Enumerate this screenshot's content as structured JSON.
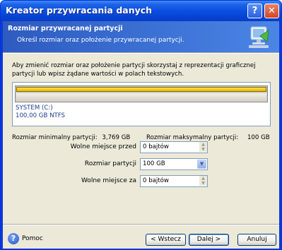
{
  "window": {
    "title": "Kreator przywracania danych",
    "help_glyph": "?",
    "close_glyph": "✕"
  },
  "header": {
    "title": "Rozmiar przywracanej partycji",
    "subtitle": "Określ rozmiar oraz położenie przywracanej partycji."
  },
  "description": "Aby zmienić rozmiar oraz położenie partycji skorzystaj z reprezentacji graficznej partycji lub wpisz żądane wartości w polach tekstowych.",
  "partition": {
    "name": "SYSTEM (C:)",
    "info": "100,00 GB  NTFS",
    "fill_fraction": 1.0
  },
  "size_limits": {
    "min_label": "Rozmiar minimalny partycji:",
    "min_value": "3,769 GB",
    "max_label": "Rozmiar maksymalny partycji:",
    "max_value": "100 GB"
  },
  "form": {
    "free_before_label": "Wolne miejsce przed",
    "free_before_value": "0 bajtów",
    "size_label": "Rozmiar partycji",
    "size_value": "100 GB",
    "free_after_label": "Wolne miejsce za",
    "free_after_value": "0 bajtów"
  },
  "footer": {
    "help_label": "Pomoc",
    "back_label": "< Wstecz",
    "next_label": "Dalej >",
    "cancel_label": "Anuluj"
  },
  "colors": {
    "titlebar": "#0b4fe0",
    "header": "#3d73d6",
    "partition_fill": "#f0c800"
  }
}
